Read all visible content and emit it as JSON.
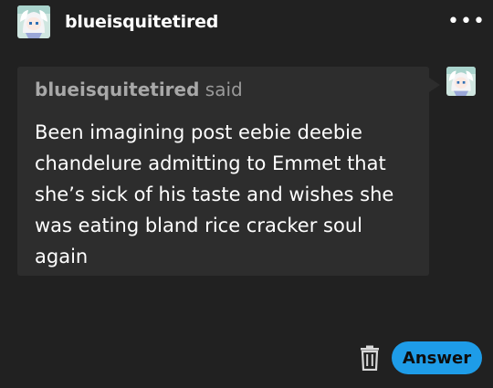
{
  "post": {
    "author": "blueisquitetired",
    "more_glyph": "•••",
    "more_icon": "ellipsis-icon"
  },
  "ask": {
    "asker": "blueisquitetired",
    "said": "said",
    "text": "Been imagining post eebie deebie chandelure admitting to Emmet that she’s sick of his taste and wishes she was eating bland rice cracker soul again"
  },
  "footer": {
    "delete_icon": "trash-icon",
    "answer_label": "Answer"
  },
  "colors": {
    "background": "#212121",
    "bubble": "#2d2d2d",
    "answer_button": "#1e9ce8",
    "muted_text": "#9a9a9a"
  }
}
